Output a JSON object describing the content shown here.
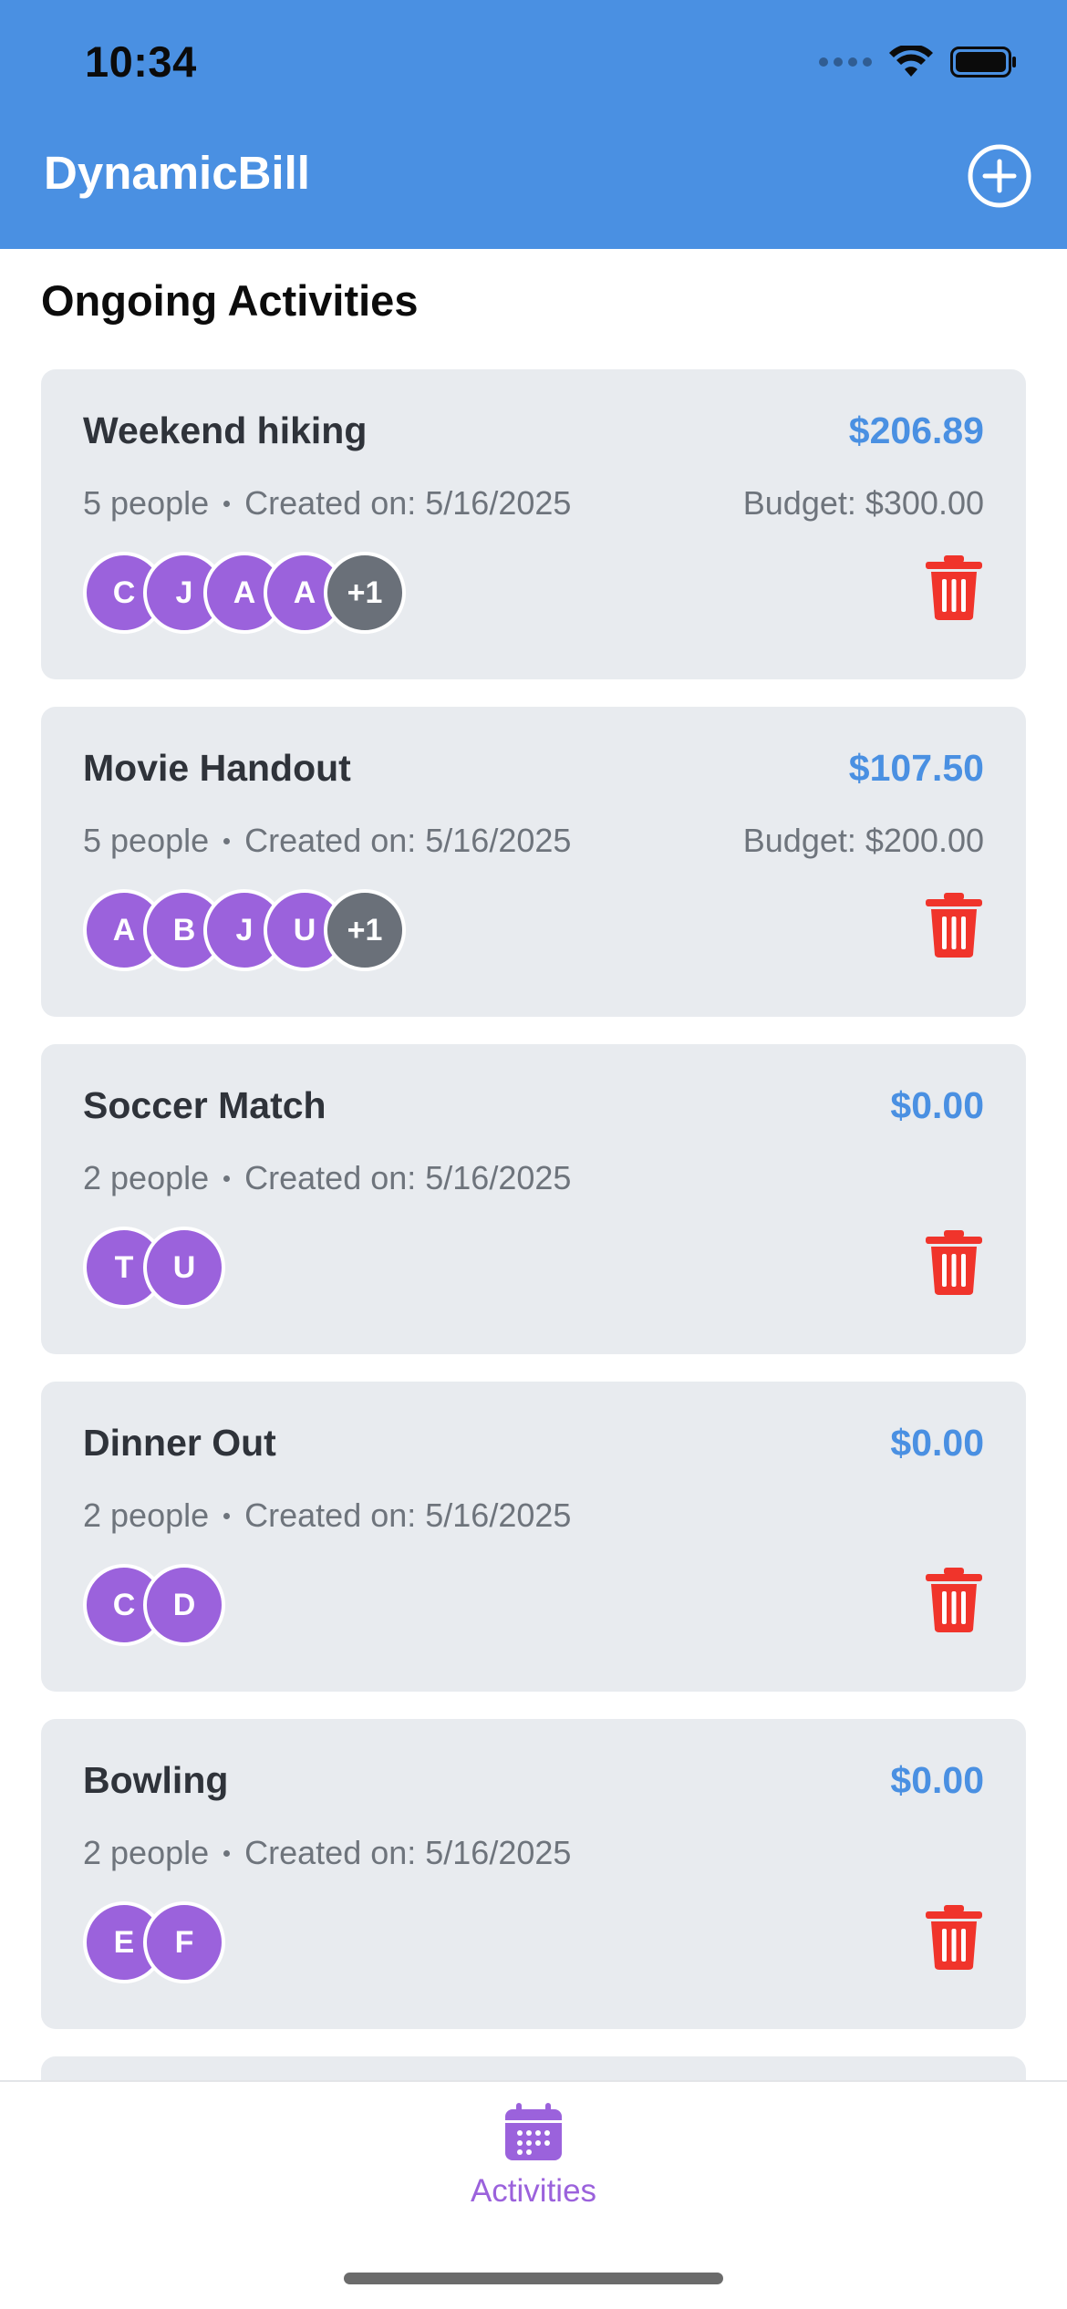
{
  "status_bar": {
    "time": "10:34"
  },
  "header": {
    "title": "DynamicBill",
    "add_icon": "plus-circle-icon",
    "background": "#4a90e2"
  },
  "section": {
    "title": "Ongoing Activities"
  },
  "activities": [
    {
      "name": "Weekend hiking",
      "total": "$206.89",
      "people": "5 people",
      "created": "Created on: 5/16/2025",
      "budget": "Budget: $300.00",
      "avatars": [
        "C",
        "J",
        "A",
        "A"
      ],
      "more": "+1"
    },
    {
      "name": "Movie Handout",
      "total": "$107.50",
      "people": "5 people",
      "created": "Created on: 5/16/2025",
      "budget": "Budget: $200.00",
      "avatars": [
        "A",
        "B",
        "J",
        "U"
      ],
      "more": "+1"
    },
    {
      "name": "Soccer Match",
      "total": "$0.00",
      "people": "2 people",
      "created": "Created on: 5/16/2025",
      "budget": "",
      "avatars": [
        "T",
        "U"
      ],
      "more": ""
    },
    {
      "name": "Dinner Out",
      "total": "$0.00",
      "people": "2 people",
      "created": "Created on: 5/16/2025",
      "budget": "",
      "avatars": [
        "C",
        "D"
      ],
      "more": ""
    },
    {
      "name": "Bowling",
      "total": "$0.00",
      "people": "2 people",
      "created": "Created on: 5/16/2025",
      "budget": "",
      "avatars": [
        "E",
        "F"
      ],
      "more": ""
    },
    {
      "name": "",
      "total": "",
      "people": "",
      "created": "",
      "budget": "",
      "avatars": [],
      "more": ""
    }
  ],
  "tabbar": {
    "activities_label": "Activities",
    "activities_icon": "calendar-icon"
  },
  "colors": {
    "accent": "#4a90e2",
    "avatar": "#9b62dc",
    "avatar_more": "#6a7079",
    "delete": "#f0342b",
    "card": "#e8ebef"
  }
}
